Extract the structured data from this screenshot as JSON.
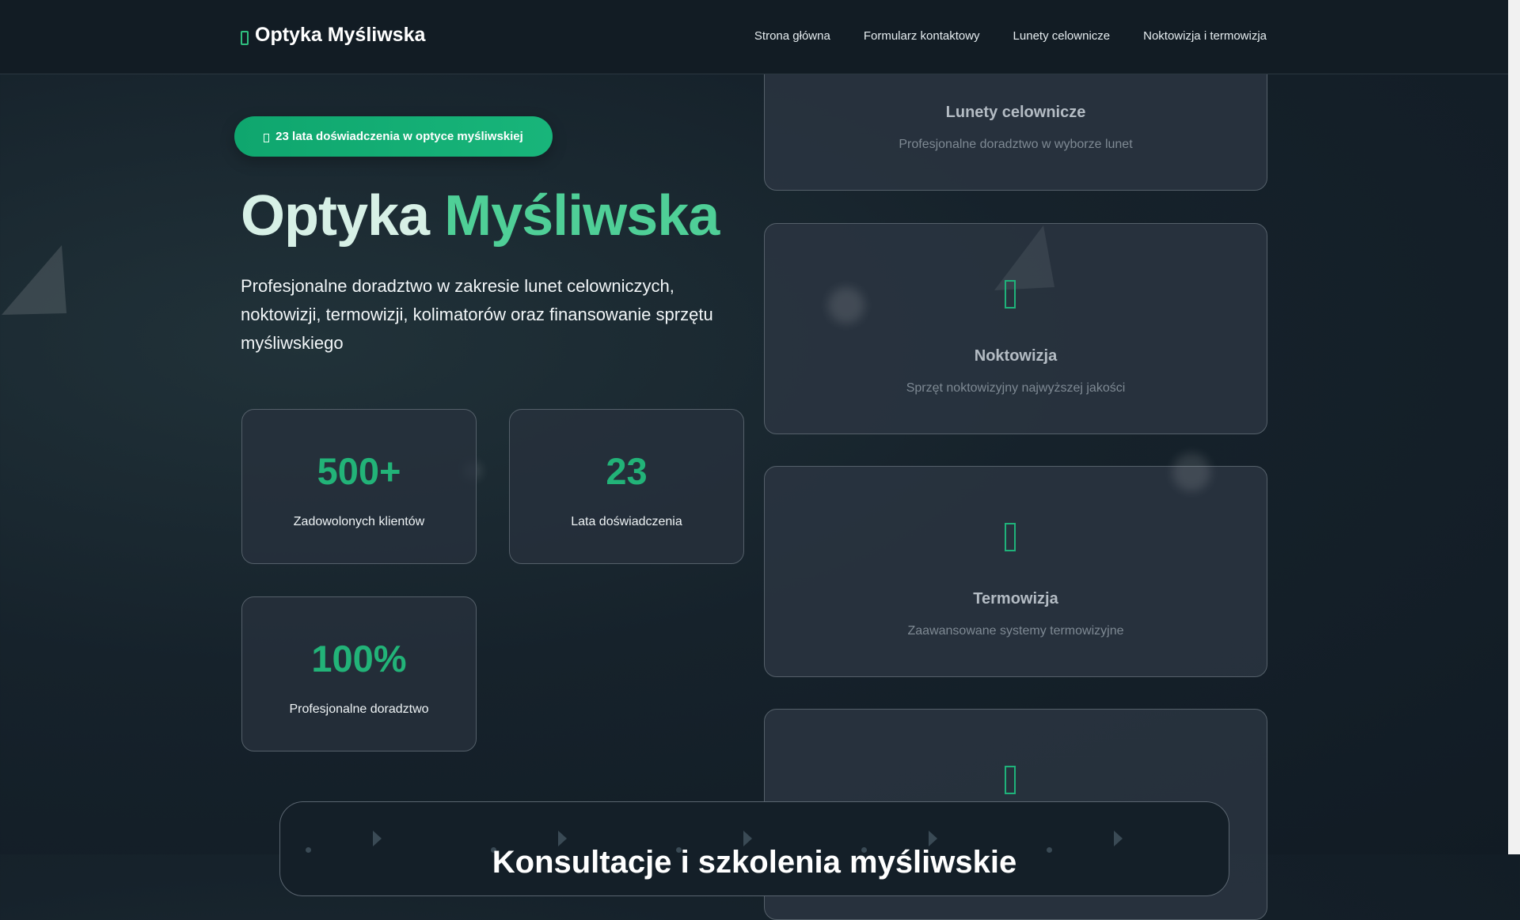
{
  "brand": {
    "name": "Optyka Myśliwska",
    "icon": "scope-icon"
  },
  "nav": {
    "links": [
      "Strona główna",
      "Formularz kontaktowy",
      "Lunety celownicze",
      "Noktowizja i termowizja"
    ]
  },
  "hero": {
    "badge": "23 lata doświadczenia w optyce myśliwskiej",
    "title_part1": "Optyka",
    "title_part2": "Myśliwska",
    "description": "Profesjonalne doradztwo w zakresie lunet celowniczych, noktowizji, termowizji, kolimatorów oraz finansowanie sprzętu myśliwskiego"
  },
  "stats": [
    {
      "value": "500+",
      "label": "Zadowolonych klientów"
    },
    {
      "value": "23",
      "label": "Lata doświadczenia"
    },
    {
      "value": "100%",
      "label": "Profesjonalne doradztwo"
    }
  ],
  "features": [
    {
      "title": "Lunety celownicze",
      "subtitle": "Profesjonalne doradztwo w wyborze lunet",
      "icon": "crosshair-icon"
    },
    {
      "title": "Noktowizja",
      "subtitle": "Sprzęt noktowizyjny najwyższej jakości",
      "icon": "moon-icon"
    },
    {
      "title": "Termowizja",
      "subtitle": "Zaawansowane systemy termowizyjne",
      "icon": "thermometer-icon"
    },
    {
      "title": "",
      "subtitle": "",
      "icon": "dot-circle-icon"
    }
  ],
  "consult": {
    "title": "Konsultacje i szkolenia myśliwskie"
  },
  "colors": {
    "accent": "#1fb27a",
    "title_accent": "#4fcf97",
    "background": "#16222b"
  }
}
